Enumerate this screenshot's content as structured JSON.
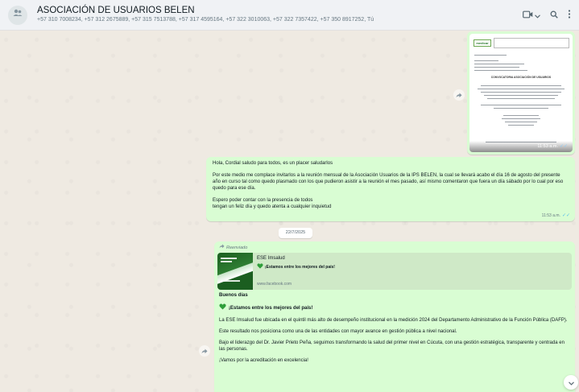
{
  "header": {
    "title": "ASOCIACIÓN DE USUARIOS BELEN",
    "members": "+57 310 7008234, +57 312 2675889, +57 315 7513788, +57 317 4595164, +57 322 3010063, +57 322 7357422, +57 350 8917252, Tú",
    "icons": [
      "group-avatar-icon",
      "video-call-icon",
      "chevron-down-icon",
      "search-icon",
      "menu-icon"
    ]
  },
  "image_message": {
    "doc": {
      "logo": "medicar",
      "heading": "CONVOCATORIA ASOCIACIÓN DE USUARIOS"
    },
    "time": "11:53 a.m."
  },
  "text_message": {
    "paragraphs": [
      "Hola, Cordial saludo para todos, es un placer saludarlos",
      "Por este medio me complace invitarlos a la reunión mensual de la Asociación Usuarios de la IPS BELEN, la cual se llevará acabo el día 16 de agosto del presente año en curso tal como quedo plasmado con los que pudieron asistir a la reunión el mes pasado, así mismo comentaron que fuera un día sábado por lo cual por eso quedo para ese día.",
      "Espero poder contar con la presencia de todos",
      "tengan un feliz día y quedo atenta a cualquier inquietud"
    ],
    "time": "11:53 a.m."
  },
  "date_divider": "22/7/2025",
  "post_message": {
    "forwarded_label": "Reenviado",
    "preview": {
      "title": "ESE Imsalud",
      "description": "¡Estamos entre los mejores del país!",
      "url": "www.facebook.com"
    },
    "greeting": "Buenos días",
    "headline": "¡Estamos entre los mejores del país!",
    "paragraphs": [
      "La ESE Imsalud fue ubicada en el quintil más alto de desempeño institucional en la medición 2024 del Departamento Administrativo de la Función Pública (DAFP).",
      "Este resultado nos posiciona como una de las entidades con mayor avance en gestión pública a nivel nacional.",
      "Bajo el liderazgo del Dr. Javier Prieto Peña, seguimos transformando la salud del primer nivel en Cúcuta, con una gestión estratégica, transparente y centrada en las personas.",
      "¡Vamos por la acreditación en excelencia!"
    ]
  },
  "colors": {
    "bubble_out": "#d9fdd3",
    "chat_bg": "#efeae2",
    "header_bg": "#f0f2f5",
    "read_ticks": "#53bdeb",
    "heart": "#2e9e3a"
  }
}
